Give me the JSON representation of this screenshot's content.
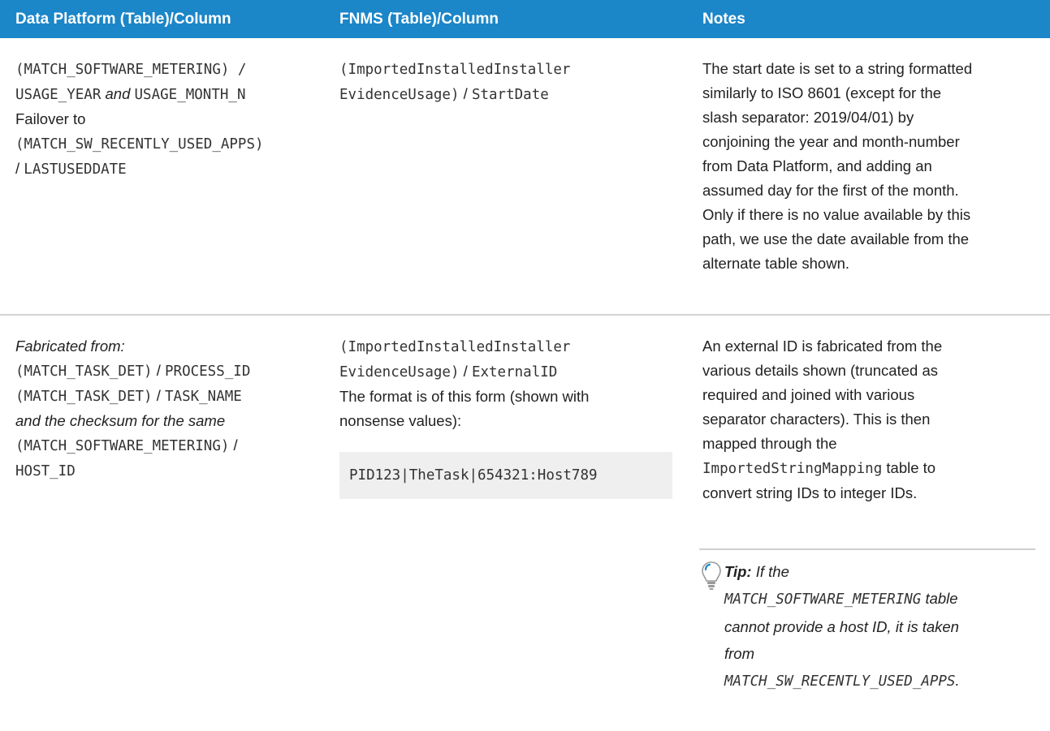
{
  "table": {
    "headers": [
      "Data Platform (Table)/Column",
      "FNMS (Table)/Column",
      "Notes"
    ],
    "row1": {
      "dp": {
        "l1_code": "(MATCH_SOFTWARE_METERING) /",
        "l2_code_a": "USAGE_YEAR",
        "l2_and": "and",
        "l2_code_b": "USAGE_MONTH_N",
        "l3": "Failover to",
        "l4_code": "(MATCH_SW_RECENTLY_USED_APPS)",
        "l5_slash": "/ ",
        "l5_code": "LASTUSEDDATE"
      },
      "fnms": {
        "l1_code": "(ImportedInstalledInstaller",
        "l2_code_a": "EvidenceUsage)",
        "l2_slash": " / ",
        "l2_code_b": "StartDate"
      },
      "notes": [
        "The start date is set to a string formatted",
        "similarly to ISO 8601 (except for the",
        "slash separator: 2019/04/01) by",
        "conjoining the year and month-number",
        "from Data Platform, and adding an",
        "assumed day for the first of the month.",
        "Only if there is no value available by this",
        "path, we use the date available from the",
        "alternate table shown."
      ]
    },
    "row2": {
      "dp": {
        "l1": "Fabricated from:",
        "l2_code_a": "(MATCH_TASK_DET)",
        "l2_slash": " / ",
        "l2_code_b": "PROCESS_ID",
        "l3_code_a": "(MATCH_TASK_DET)",
        "l3_slash": " / ",
        "l3_code_b": "TASK_NAME",
        "l4": "and the checksum for the same",
        "l5_code": "(MATCH_SOFTWARE_METERING)",
        "l5_slash": " /",
        "l6_code": "HOST_ID"
      },
      "fnms": {
        "l1_code": "(ImportedInstalledInstaller",
        "l2_code_a": "EvidenceUsage)",
        "l2_slash": " / ",
        "l2_code_b": "ExternalID",
        "l3": "The format is of this form (shown with",
        "l4": "nonsense values):",
        "code_example": "PID123|TheTask|654321:Host789"
      },
      "notes": {
        "l1": "An external ID is fabricated from the",
        "l2": "various details shown (truncated as",
        "l3": "required and joined with various",
        "l4": "separator characters). This is then",
        "l5": "mapped through the",
        "l6_code": "ImportedStringMapping",
        "l6_rest": " table to",
        "l7": "convert string IDs to integer IDs."
      },
      "tip": {
        "icon": "lightbulb-icon",
        "label": "Tip:",
        "l1_rest": " If the",
        "l2_code": "MATCH_SOFTWARE_METERING",
        "l2_rest": " table",
        "l3": "cannot provide a host ID, it is taken",
        "l4": "from",
        "l5_code": "MATCH_SW_RECENTLY_USED_APPS",
        "l5_rest": "."
      }
    }
  },
  "colors": {
    "header_bg": "#1b86c8",
    "header_text": "#ffffff",
    "code_bg": "#efefef",
    "separator": "#d3d3d3"
  }
}
